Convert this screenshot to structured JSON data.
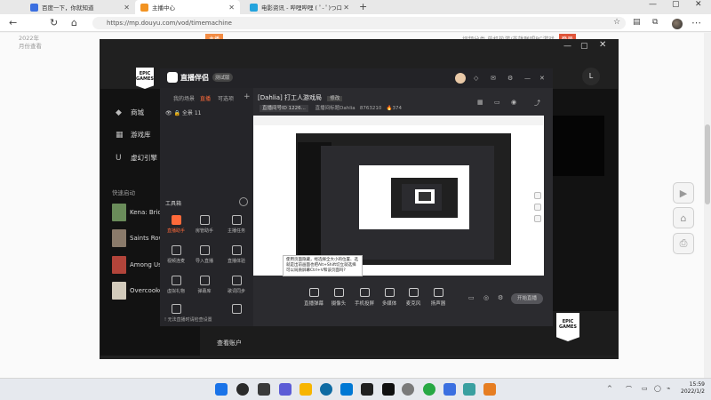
{
  "browser": {
    "tabs": [
      {
        "title": "百度一下，你就知道",
        "favicon_color": "#3b6fe0",
        "active": false
      },
      {
        "title": "主播中心",
        "favicon_color": "#f29322",
        "active": true
      },
      {
        "title": "电影资讯 - 哔哩哔哩 ( ﾟ- ﾟ)つロ",
        "favicon_color": "#23a3dd",
        "active": false
      }
    ],
    "new_tab": "+",
    "window_controls": [
      "—",
      "▢",
      "✕"
    ],
    "url": "https://mp.douyu.com/vod/timemachine",
    "nav": {
      "back": "←",
      "refresh": "↻",
      "home": "⌂"
    }
  },
  "page": {
    "left_text": [
      "2022年",
      "月份查看"
    ],
    "badge": "主播",
    "top_right": "视频分类  单机热游/英雄联盟PC游戏",
    "top_right_btn": "登录",
    "side_tools": [
      "▶",
      "⌂",
      "⎙"
    ]
  },
  "epic": {
    "logo_line1": "EPIC",
    "logo_line2": "GAMES",
    "user_initial": "L",
    "nav": [
      {
        "icon": "◆",
        "label": "商城"
      },
      {
        "icon": "▦",
        "label": "游戏库"
      },
      {
        "icon": "U",
        "label": "虚幻引擎"
      }
    ],
    "quick_launch": "快速启动",
    "games": [
      {
        "label": "Kena: Bridg",
        "color": "#6a8c5a"
      },
      {
        "label": "Saints Row",
        "color": "#8a7a6a"
      },
      {
        "label": "Among Us",
        "color": "#b2443a"
      },
      {
        "label": "Overcooked",
        "color": "#d2cabb"
      }
    ],
    "bottom_link": "查看账户",
    "win_controls": [
      "✕",
      "—",
      "▢",
      "✕"
    ]
  },
  "companion": {
    "brand": "直播伴侣",
    "brand_pill": "测试版",
    "tabs": [
      "我的场景",
      "直播",
      "可选项"
    ],
    "scene_label": "全景 11",
    "tool_title": "工具箱",
    "tools": [
      "直播助手",
      "房管助手",
      "主播任务",
      "视频连麦",
      "导入直播",
      "直播体验",
      "虚拟礼物",
      "弹幕库",
      "歌词同步"
    ],
    "warning": "! 无法直播时请检查设置",
    "title": "[Dahlia] 打工人游戏局",
    "title_tag": "修改",
    "meta": [
      "直播间号ID 1226...",
      "直播间标题Dahlia",
      "8763210",
      "374"
    ],
    "bottom": [
      "直播弹幕",
      "摄像头",
      "手机投屏",
      "多媒体",
      "麦克风",
      "扬声器"
    ],
    "start_button": "开始直播",
    "tooltip": "使用页面隐藏，经选择全大小的位置、选就是出前画面也把Alt+Shift切立就选择可以局质屏幕Ctrl+V和该页面吗?"
  },
  "taskbar": {
    "apps": [
      "#1a73e8",
      "#2b2b2b",
      "#3a3a3a",
      "#f7b500",
      "#0078d4",
      "#0f6ba3",
      "#202020",
      "#111111",
      "#7a7a7a",
      "#27a844",
      "#3b6fe0",
      "#3aa0a0",
      "#e67e22"
    ],
    "tray": [
      "^",
      "⌒",
      "▭",
      "◯",
      "⌁"
    ],
    "time": "15:59",
    "date": "2022/1/2"
  }
}
